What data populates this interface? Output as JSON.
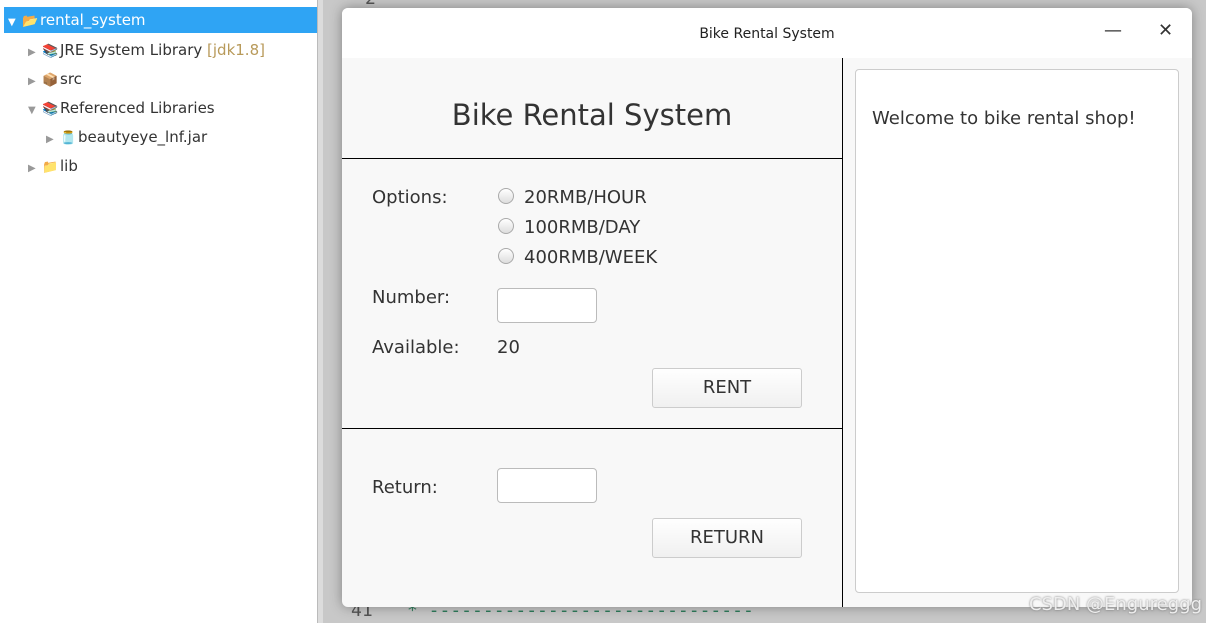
{
  "explorer": {
    "items": [
      {
        "label": "rental_system",
        "expanded": true,
        "selected": true,
        "icon": "project-icon"
      },
      {
        "label": "JRE System Library",
        "suffix": "[jdk1.8]",
        "icon": "library-icon"
      },
      {
        "label": "src",
        "icon": "package-folder-icon"
      },
      {
        "label": "Referenced Libraries",
        "expanded": true,
        "icon": "library-icon"
      },
      {
        "label": "beautyeye_lnf.jar",
        "icon": "jar-icon"
      },
      {
        "label": "lib",
        "icon": "folder-icon"
      }
    ]
  },
  "editor": {
    "line_top": "2",
    "line_bottom": "41",
    "bottom_code": "*   ------------------------------"
  },
  "dialog": {
    "title": "Bike Rental System",
    "heading": "Bike Rental System",
    "options_label": "Options:",
    "options": [
      "20RMB/HOUR",
      "100RMB/DAY",
      "400RMB/WEEK"
    ],
    "number_label": "Number:",
    "number_value": "",
    "available_label": "Available:",
    "available_value": "20",
    "rent_button": "RENT",
    "return_label": "Return:",
    "return_value": "",
    "return_button": "RETURN",
    "output_text": "Welcome to bike rental shop!"
  },
  "watermark": "CSDN @Engureggg"
}
